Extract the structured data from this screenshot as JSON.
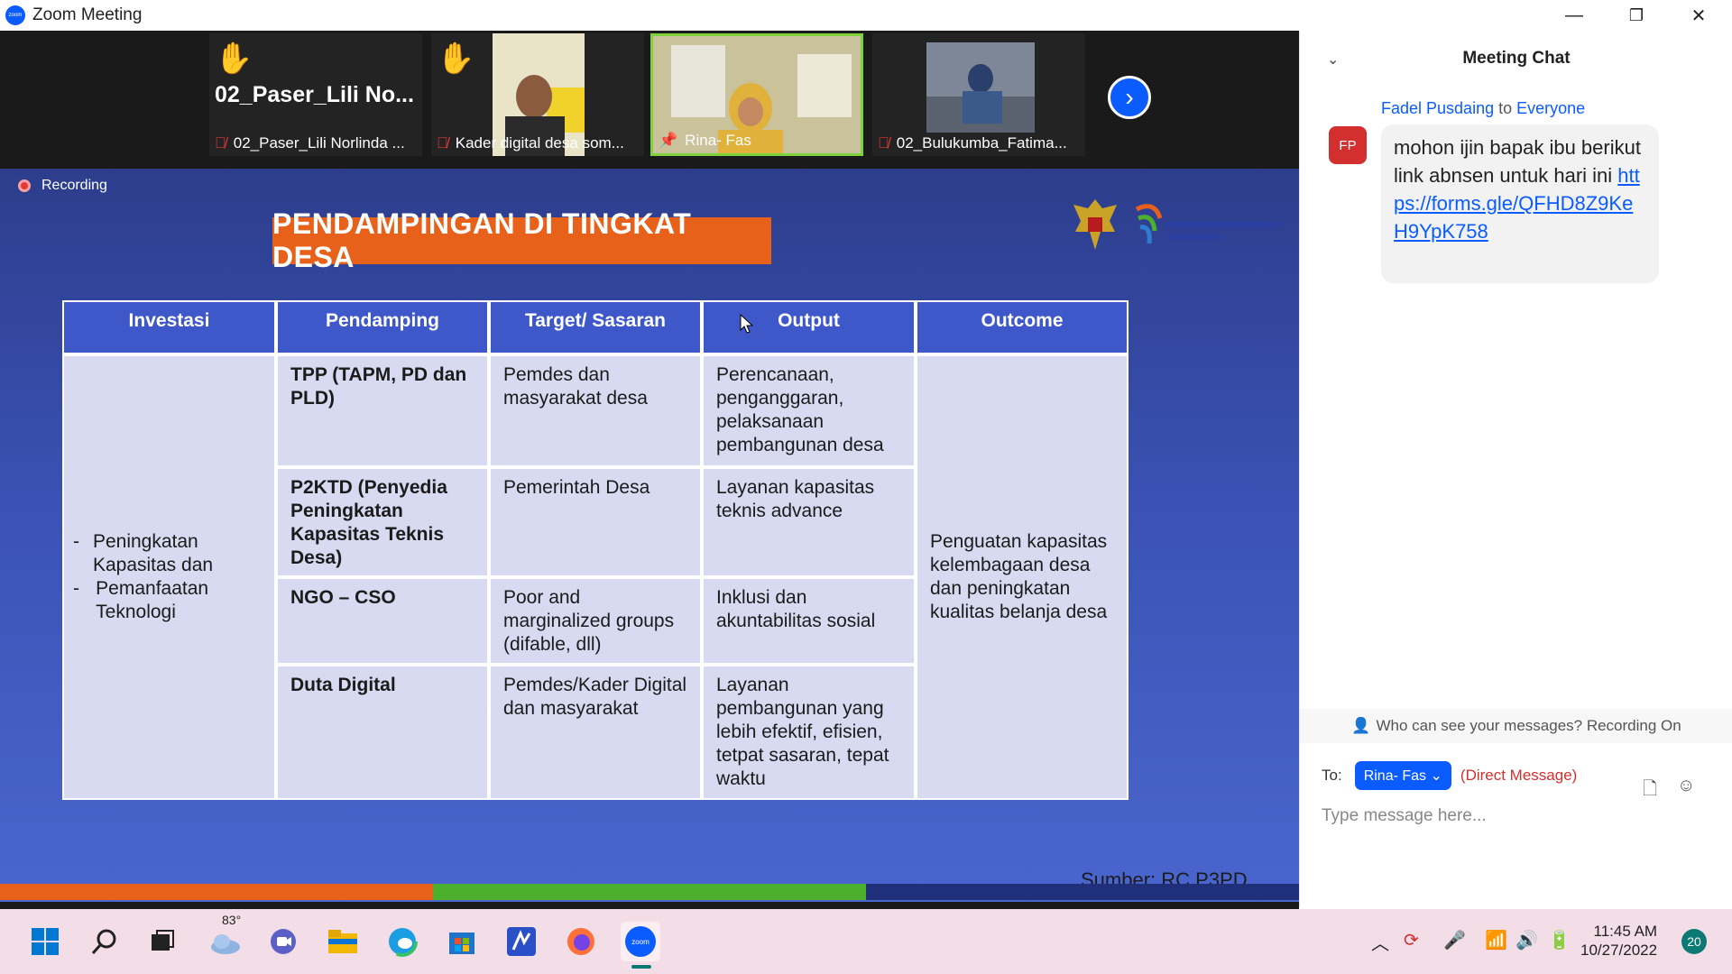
{
  "window": {
    "title": "Zoom Meeting",
    "minimize": "—",
    "restore": "❐",
    "close": "✕"
  },
  "participants": [
    {
      "name": "02_Paser_Lili Norlinda ...",
      "big_label": "02_Paser_Lili  No...",
      "hand": "✋",
      "muted": true
    },
    {
      "name": "Kader digital desa som...",
      "hand": "✋",
      "muted": true
    },
    {
      "name": "Rina- Fas",
      "pinned": true,
      "active": true
    },
    {
      "name": "02_Bulukumba_Fatima...",
      "muted": true
    }
  ],
  "slide": {
    "recording_label": "Recording",
    "title": "PENDAMPINGAN DI TINGKAT DESA",
    "source": "Sumber: RC P3PD",
    "headers": [
      "Investasi",
      "Pendamping",
      "Target/ Sasaran",
      "Output",
      "Outcome"
    ],
    "investasi": [
      "Peningkatan Kapasitas dan",
      "Pemanfaatan Teknologi"
    ],
    "rows": [
      {
        "pendamping": "TPP (TAPM, PD dan PLD)",
        "target": "Pemdes dan masyarakat desa",
        "output": "Perencanaan, penganggaran, pelaksanaan pembangunan desa"
      },
      {
        "pendamping": "P2KTD  (Penyedia Peningkatan Kapasitas Teknis Desa)",
        "target": "Pemerintah Desa",
        "output": "Layanan kapasitas teknis advance"
      },
      {
        "pendamping": "NGO – CSO",
        "target": "Poor and marginalized groups (difable, dll)",
        "output": "Inklusi dan akuntabilitas sosial"
      },
      {
        "pendamping": "Duta Digital",
        "target": "Pemdes/Kader Digital dan masyarakat",
        "output": "Layanan pembangunan yang lebih efektif, efisien, tetpat sasaran, tepat waktu"
      }
    ],
    "outcome": "Penguatan kapasitas kelembagaan desa dan peningkatan kualitas belanja desa",
    "bar_colors": [
      "#e8611a",
      "#4caf2e",
      "#1f2f7a"
    ]
  },
  "chat": {
    "title": "Meeting Chat",
    "sender": "Fadel Pusdaing",
    "to_word": "to",
    "recipient": "Everyone",
    "avatar_initials": "FP",
    "message": "mohon ijin bapak ibu berikut link abnsen untuk hari ini",
    "link": "https://forms.gle/QFHD8Z9KeH9YpK758",
    "visibility_note": "Who can see your messages? Recording On",
    "to_label": "To:",
    "to_target": "Rina- Fas",
    "direct_message": "(Direct Message)",
    "input_placeholder": "Type message here..."
  },
  "taskbar": {
    "temperature": "83°",
    "time": "11:45 AM",
    "date": "10/27/2022",
    "notifications": "20"
  }
}
